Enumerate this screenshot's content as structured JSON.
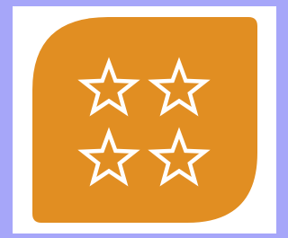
{
  "icon": {
    "name": "four-stars-rating-icon",
    "tile_color": "#e18e22",
    "star_outline_color": "#ffffff",
    "star_count": 4
  },
  "colors": {
    "outer_background": "#a6a6f9",
    "frame_background": "#ffffff"
  }
}
